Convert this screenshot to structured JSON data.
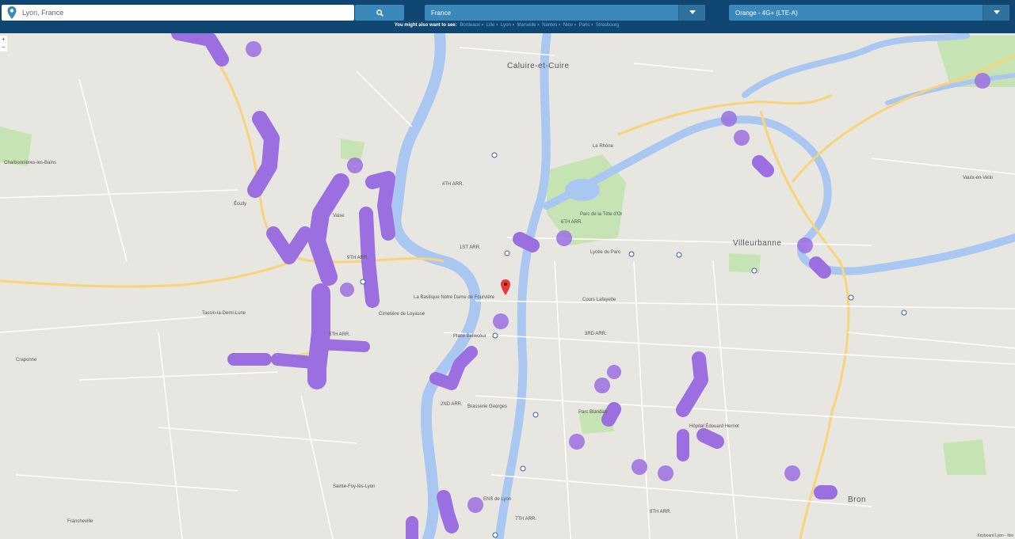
{
  "search": {
    "value": "Lyon, France",
    "placeholder": "Lyon, France",
    "button_icon": "search-icon"
  },
  "country_select": {
    "selected": "France"
  },
  "network_select": {
    "selected": "Orange - 4G+ (LTE-A)"
  },
  "suggestions": {
    "prefix": "You might also want to see:",
    "links": [
      "Bordeaux",
      "Lille",
      "Lyon",
      "Marseille",
      "Nantes",
      "Nice",
      "Paris",
      "Strasbourg"
    ]
  },
  "zoom": {
    "in": "+",
    "out": "−"
  },
  "map": {
    "labels": [
      "Caluire-et-Cuire",
      "Charbonnières-les-Bains",
      "Écully",
      "Tassin-la-Demi-Lune",
      "Villeurbanne",
      "Vaulx-en-Velin",
      "Bron",
      "Sainte-Foy-lès-Lyon",
      "Francheville",
      "4TH ARR.",
      "1ST ARR.",
      "9TH ARR.",
      "5TH ARR.",
      "6TH ARR.",
      "3RD ARR.",
      "2ND ARR.",
      "7TH ARR.",
      "8TH ARR.",
      "Parc de la Tête d'Or",
      "La Basilique Notre Dame de Fourvière",
      "Place Bellecour",
      "Parc Blandan",
      "Cimetière de Loyasse",
      "Lycée du Parc",
      "Cours Lafayette",
      "Hôpital Édouard Herriot",
      "ENS de Lyon",
      "Brasserie Georges",
      "Le Rhône",
      "Craponne",
      "Vaise"
    ],
    "coverage_color": "#9b6fe0",
    "water_color": "#aac7f2",
    "park_color": "#c6e3b4",
    "marker_color": "#e53935"
  },
  "attribution": "Keyboard Lyon - Ibis"
}
